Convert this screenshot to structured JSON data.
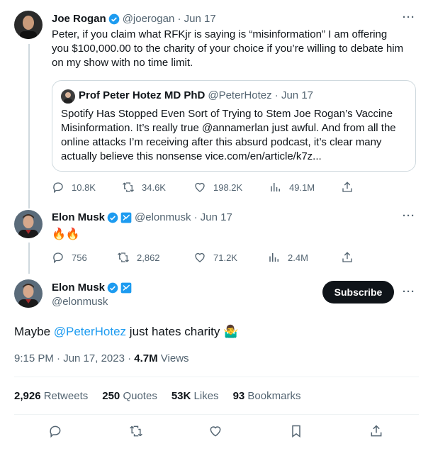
{
  "tweet1": {
    "name": "Joe Rogan",
    "handle": "@joerogan",
    "date": "Jun 17",
    "text": "Peter, if you claim what RFKjr is saying is “misinformation” I am offering you $100,000.00 to the charity of your choice if you’re willing to debate him on my show with no time limit.",
    "more": "···",
    "quote": {
      "name": "Prof Peter Hotez MD PhD",
      "handle": "@PeterHotez",
      "date": "Jun 17",
      "text": "Spotify Has Stopped Even Sort of Trying to Stem Joe Rogan’s Vaccine Misinformation. It’s really true @annamerlan just awful. And from all the online attacks I’m receiving after this absurd podcast, it’s clear many actually believe this nonsense vice.com/en/article/k7z..."
    },
    "stats": {
      "replies": "10.8K",
      "retweets": "34.6K",
      "likes": "198.2K",
      "views": "49.1M"
    }
  },
  "tweet2": {
    "name": "Elon Musk",
    "handle": "@elonmusk",
    "date": "Jun 17",
    "text": "🔥🔥",
    "more": "···",
    "stats": {
      "replies": "756",
      "retweets": "2,862",
      "likes": "71.2K",
      "views": "2.4M"
    }
  },
  "main": {
    "name": "Elon Musk",
    "handle": "@elonmusk",
    "subscribe_label": "Subscribe",
    "more": "···",
    "text_before": "Maybe ",
    "mention": "@PeterHotez",
    "text_after": " just hates charity 🤷‍♂️",
    "time": "9:15 PM · Jun 17, 2023 · ",
    "views_count": "4.7M",
    "views_label": " Views",
    "retweets_count": "2,926",
    "retweets_label": "Retweets",
    "quotes_count": "250",
    "quotes_label": "Quotes",
    "likes_count": "53K",
    "likes_label": "Likes",
    "bookmarks_count": "93",
    "bookmarks_label": "Bookmarks"
  },
  "colors": {
    "verified": "#1d9bf0",
    "link": "#1d9bf0",
    "text": "#0f1419",
    "muted": "#536471"
  }
}
